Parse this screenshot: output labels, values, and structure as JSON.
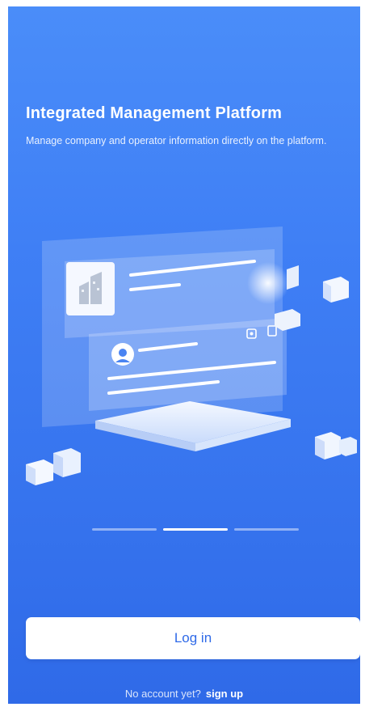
{
  "onboarding": {
    "title": "Integrated Management Platform",
    "subtitle": "Manage company and operator information directly on the platform.",
    "pager": {
      "total": 3,
      "active_index": 1
    },
    "login_label": "Log in",
    "footer": {
      "hint": "No account yet?",
      "signup": "sign up"
    }
  },
  "colors": {
    "background_top": "#4a8df9",
    "background_bottom": "#2f6ae8",
    "button_background": "#ffffff",
    "button_text": "#2f6ae8"
  },
  "icons": [
    "building-icon",
    "user-avatar-icon",
    "settings-icon",
    "delete-icon"
  ]
}
